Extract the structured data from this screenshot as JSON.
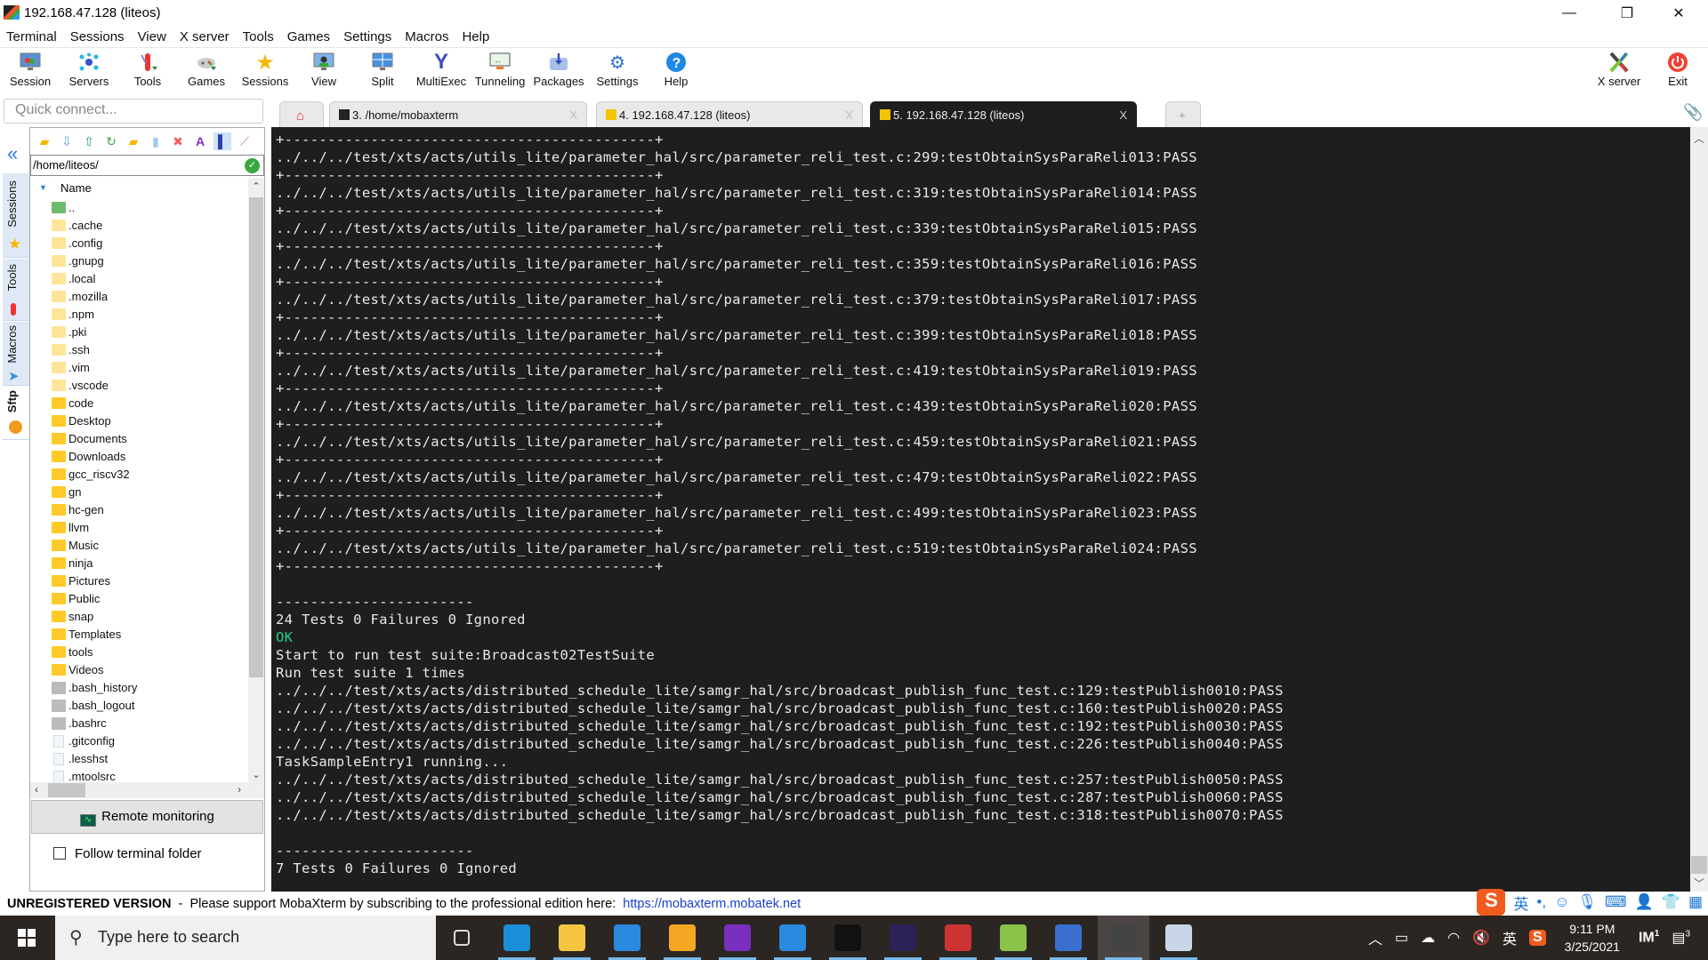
{
  "window": {
    "title": "192.168.47.128 (liteos)",
    "minimize_glyph": "—",
    "maximize_glyph": "❐",
    "close_glyph": "✕"
  },
  "menu": [
    "Terminal",
    "Sessions",
    "View",
    "X server",
    "Tools",
    "Games",
    "Settings",
    "Macros",
    "Help"
  ],
  "toolbar": [
    {
      "label": "Session",
      "icon": "session-icon"
    },
    {
      "label": "Servers",
      "icon": "servers-icon"
    },
    {
      "label": "Tools",
      "icon": "tools-icon"
    },
    {
      "label": "Games",
      "icon": "games-icon"
    },
    {
      "label": "Sessions",
      "icon": "star-icon"
    },
    {
      "label": "View",
      "icon": "view-icon"
    },
    {
      "label": "Split",
      "icon": "split-icon"
    },
    {
      "label": "MultiExec",
      "icon": "multiexec-icon"
    },
    {
      "label": "Tunneling",
      "icon": "tunneling-icon"
    },
    {
      "label": "Packages",
      "icon": "packages-icon"
    },
    {
      "label": "Settings",
      "icon": "settings-icon"
    },
    {
      "label": "Help",
      "icon": "help-icon"
    }
  ],
  "toolbar_right": [
    {
      "label": "X server",
      "icon": "x-server-icon"
    },
    {
      "label": "Exit",
      "icon": "power-icon"
    }
  ],
  "quick_connect": {
    "placeholder": "Quick connect..."
  },
  "tabs": [
    {
      "label": "3. /home/mobaxterm",
      "active": false
    },
    {
      "label": "4. 192.168.47.128 (liteos)",
      "active": false
    },
    {
      "label": "5. 192.168.47.128 (liteos)",
      "active": true
    }
  ],
  "side_tabs": [
    {
      "label": "Sessions",
      "active": false
    },
    {
      "label": "Tools",
      "active": false
    },
    {
      "label": "Macros",
      "active": false
    },
    {
      "label": "Sftp",
      "active": true
    }
  ],
  "sftp": {
    "path": "/home/liteos/",
    "column_header": "Name",
    "files": [
      {
        "name": "..",
        "type": "parent"
      },
      {
        "name": ".cache",
        "type": "hidden-folder"
      },
      {
        "name": ".config",
        "type": "hidden-folder"
      },
      {
        "name": ".gnupg",
        "type": "hidden-folder"
      },
      {
        "name": ".local",
        "type": "hidden-folder"
      },
      {
        "name": ".mozilla",
        "type": "hidden-folder"
      },
      {
        "name": ".npm",
        "type": "hidden-folder"
      },
      {
        "name": ".pki",
        "type": "hidden-folder"
      },
      {
        "name": ".ssh",
        "type": "hidden-folder"
      },
      {
        "name": ".vim",
        "type": "hidden-folder"
      },
      {
        "name": ".vscode",
        "type": "hidden-folder"
      },
      {
        "name": "code",
        "type": "folder"
      },
      {
        "name": "Desktop",
        "type": "folder"
      },
      {
        "name": "Documents",
        "type": "folder"
      },
      {
        "name": "Downloads",
        "type": "folder"
      },
      {
        "name": "gcc_riscv32",
        "type": "folder"
      },
      {
        "name": "gn",
        "type": "folder"
      },
      {
        "name": "hc-gen",
        "type": "folder"
      },
      {
        "name": "llvm",
        "type": "folder"
      },
      {
        "name": "Music",
        "type": "folder"
      },
      {
        "name": "ninja",
        "type": "folder"
      },
      {
        "name": "Pictures",
        "type": "folder"
      },
      {
        "name": "Public",
        "type": "folder"
      },
      {
        "name": "snap",
        "type": "folder"
      },
      {
        "name": "Templates",
        "type": "folder"
      },
      {
        "name": "tools",
        "type": "folder"
      },
      {
        "name": "Videos",
        "type": "folder"
      },
      {
        "name": ".bash_history",
        "type": "shell-file"
      },
      {
        "name": ".bash_logout",
        "type": "shell-file"
      },
      {
        "name": ".bashrc",
        "type": "shell-file"
      },
      {
        "name": ".gitconfig",
        "type": "file"
      },
      {
        "name": ".lesshst",
        "type": "file"
      },
      {
        "name": ".mtoolsrc",
        "type": "file"
      }
    ],
    "remote_monitoring_label": "Remote monitoring",
    "follow_terminal_label": "Follow terminal folder",
    "follow_terminal_checked": false
  },
  "terminal": {
    "lines": [
      {
        "text": "+-------------------------------------------+"
      },
      {
        "text": "../../../test/xts/acts/utils_lite/parameter_hal/src/parameter_reli_test.c:299:testObtainSysParaReli013:PASS"
      },
      {
        "text": "+-------------------------------------------+"
      },
      {
        "text": "../../../test/xts/acts/utils_lite/parameter_hal/src/parameter_reli_test.c:319:testObtainSysParaReli014:PASS"
      },
      {
        "text": "+-------------------------------------------+"
      },
      {
        "text": "../../../test/xts/acts/utils_lite/parameter_hal/src/parameter_reli_test.c:339:testObtainSysParaReli015:PASS"
      },
      {
        "text": "+-------------------------------------------+"
      },
      {
        "text": "../../../test/xts/acts/utils_lite/parameter_hal/src/parameter_reli_test.c:359:testObtainSysParaReli016:PASS"
      },
      {
        "text": "+-------------------------------------------+"
      },
      {
        "text": "../../../test/xts/acts/utils_lite/parameter_hal/src/parameter_reli_test.c:379:testObtainSysParaReli017:PASS"
      },
      {
        "text": "+-------------------------------------------+"
      },
      {
        "text": "../../../test/xts/acts/utils_lite/parameter_hal/src/parameter_reli_test.c:399:testObtainSysParaReli018:PASS"
      },
      {
        "text": "+-------------------------------------------+"
      },
      {
        "text": "../../../test/xts/acts/utils_lite/parameter_hal/src/parameter_reli_test.c:419:testObtainSysParaReli019:PASS"
      },
      {
        "text": "+-------------------------------------------+"
      },
      {
        "text": "../../../test/xts/acts/utils_lite/parameter_hal/src/parameter_reli_test.c:439:testObtainSysParaReli020:PASS"
      },
      {
        "text": "+-------------------------------------------+"
      },
      {
        "text": "../../../test/xts/acts/utils_lite/parameter_hal/src/parameter_reli_test.c:459:testObtainSysParaReli021:PASS"
      },
      {
        "text": "+-------------------------------------------+"
      },
      {
        "text": "../../../test/xts/acts/utils_lite/parameter_hal/src/parameter_reli_test.c:479:testObtainSysParaReli022:PASS"
      },
      {
        "text": "+-------------------------------------------+"
      },
      {
        "text": "../../../test/xts/acts/utils_lite/parameter_hal/src/parameter_reli_test.c:499:testObtainSysParaReli023:PASS"
      },
      {
        "text": "+-------------------------------------------+"
      },
      {
        "text": "../../../test/xts/acts/utils_lite/parameter_hal/src/parameter_reli_test.c:519:testObtainSysParaReli024:PASS"
      },
      {
        "text": "+-------------------------------------------+"
      },
      {
        "text": ""
      },
      {
        "text": "-----------------------"
      },
      {
        "text": "24 Tests 0 Failures 0 Ignored"
      },
      {
        "text": "OK",
        "style": "ok"
      },
      {
        "text": "Start to run test suite:Broadcast02TestSuite"
      },
      {
        "text": "Run test suite 1 times"
      },
      {
        "text": "../../../test/xts/acts/distributed_schedule_lite/samgr_hal/src/broadcast_publish_func_test.c:129:testPublish0010:PASS"
      },
      {
        "text": "../../../test/xts/acts/distributed_schedule_lite/samgr_hal/src/broadcast_publish_func_test.c:160:testPublish0020:PASS"
      },
      {
        "text": "../../../test/xts/acts/distributed_schedule_lite/samgr_hal/src/broadcast_publish_func_test.c:192:testPublish0030:PASS"
      },
      {
        "text": "../../../test/xts/acts/distributed_schedule_lite/samgr_hal/src/broadcast_publish_func_test.c:226:testPublish0040:PASS"
      },
      {
        "text": "TaskSampleEntry1 running..."
      },
      {
        "text": "../../../test/xts/acts/distributed_schedule_lite/samgr_hal/src/broadcast_publish_func_test.c:257:testPublish0050:PASS"
      },
      {
        "text": "../../../test/xts/acts/distributed_schedule_lite/samgr_hal/src/broadcast_publish_func_test.c:287:testPublish0060:PASS"
      },
      {
        "text": "../../../test/xts/acts/distributed_schedule_lite/samgr_hal/src/broadcast_publish_func_test.c:318:testPublish0070:PASS"
      },
      {
        "text": ""
      },
      {
        "text": "-----------------------"
      },
      {
        "text": "7 Tests 0 Failures 0 Ignored"
      }
    ]
  },
  "status_bar": {
    "unregistered": "UNREGISTERED VERSION",
    "separator": "  -  ",
    "message": "Please support MobaXterm by subscribing to the professional edition here:  ",
    "link": "https://mobaxterm.mobatek.net"
  },
  "ime_bar": {
    "logo": "S",
    "lang": "英",
    "punct": "•,",
    "icons": [
      "emoji-icon",
      "microphone-icon",
      "keyboard-icon",
      "user-icon",
      "skin-icon",
      "grid-icon"
    ]
  },
  "taskbar": {
    "search_placeholder": "Type here to search",
    "apps": [
      {
        "name": "task-view",
        "running": false
      },
      {
        "name": "edge",
        "running": true
      },
      {
        "name": "file-explorer",
        "running": true
      },
      {
        "name": "mail",
        "running": true
      },
      {
        "name": "remote-app",
        "running": true
      },
      {
        "name": "onenote",
        "running": true
      },
      {
        "name": "vscode",
        "running": true
      },
      {
        "name": "cmd",
        "running": true
      },
      {
        "name": "eclipse",
        "running": true
      },
      {
        "name": "sync-app",
        "running": true
      },
      {
        "name": "notepad-plus",
        "running": true
      },
      {
        "name": "calculator",
        "running": true
      },
      {
        "name": "mobaxterm",
        "running": true,
        "focused": true
      },
      {
        "name": "monitor-app",
        "running": true
      }
    ],
    "tray": {
      "lang": "英",
      "time": "9:11 PM",
      "date": "3/25/2021",
      "badge_1": "1",
      "notification_count": "3"
    }
  },
  "colors": {
    "terminal_bg": "#1e1e1e",
    "terminal_fg": "#e8e8e8",
    "ok_green": "#23d18b",
    "accent_blue": "#2a7ad8",
    "link_blue": "#1a3fcc"
  }
}
